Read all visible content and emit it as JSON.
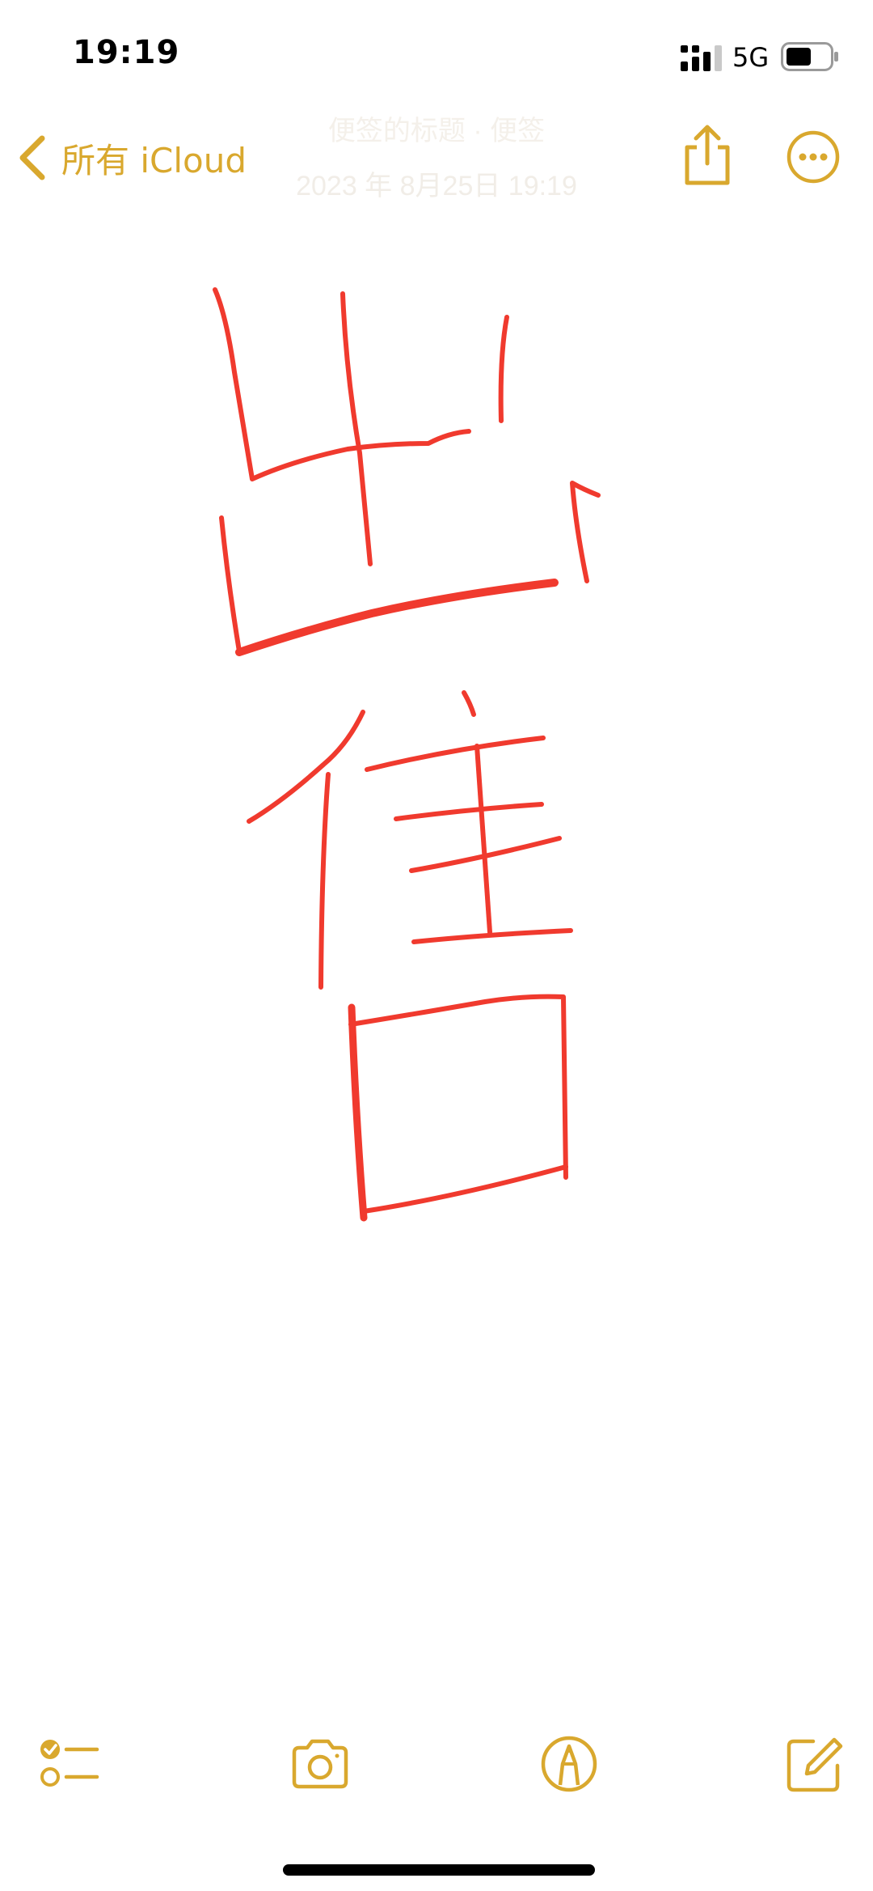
{
  "status_bar": {
    "time": "19:19",
    "network": "5G",
    "battery_icon": "battery-icon",
    "signal_icon": "cellular-signal-icon"
  },
  "nav": {
    "back_label": "所有 iCloud",
    "faded_title": "便签的标题 · 便签",
    "faded_date": "2023 年 8月25日 19:19",
    "share_icon": "share-icon",
    "more_icon": "more-icon"
  },
  "note": {
    "handwritten_text": "出售",
    "ink_color": "#F03A2E"
  },
  "toolbar": {
    "items": [
      {
        "icon": "checklist-icon"
      },
      {
        "icon": "camera-icon"
      },
      {
        "icon": "markup-pen-icon"
      },
      {
        "icon": "compose-icon"
      }
    ]
  },
  "colors": {
    "accent": "#D9A82E",
    "ink": "#F03A2E",
    "background": "#FFFFFF"
  }
}
